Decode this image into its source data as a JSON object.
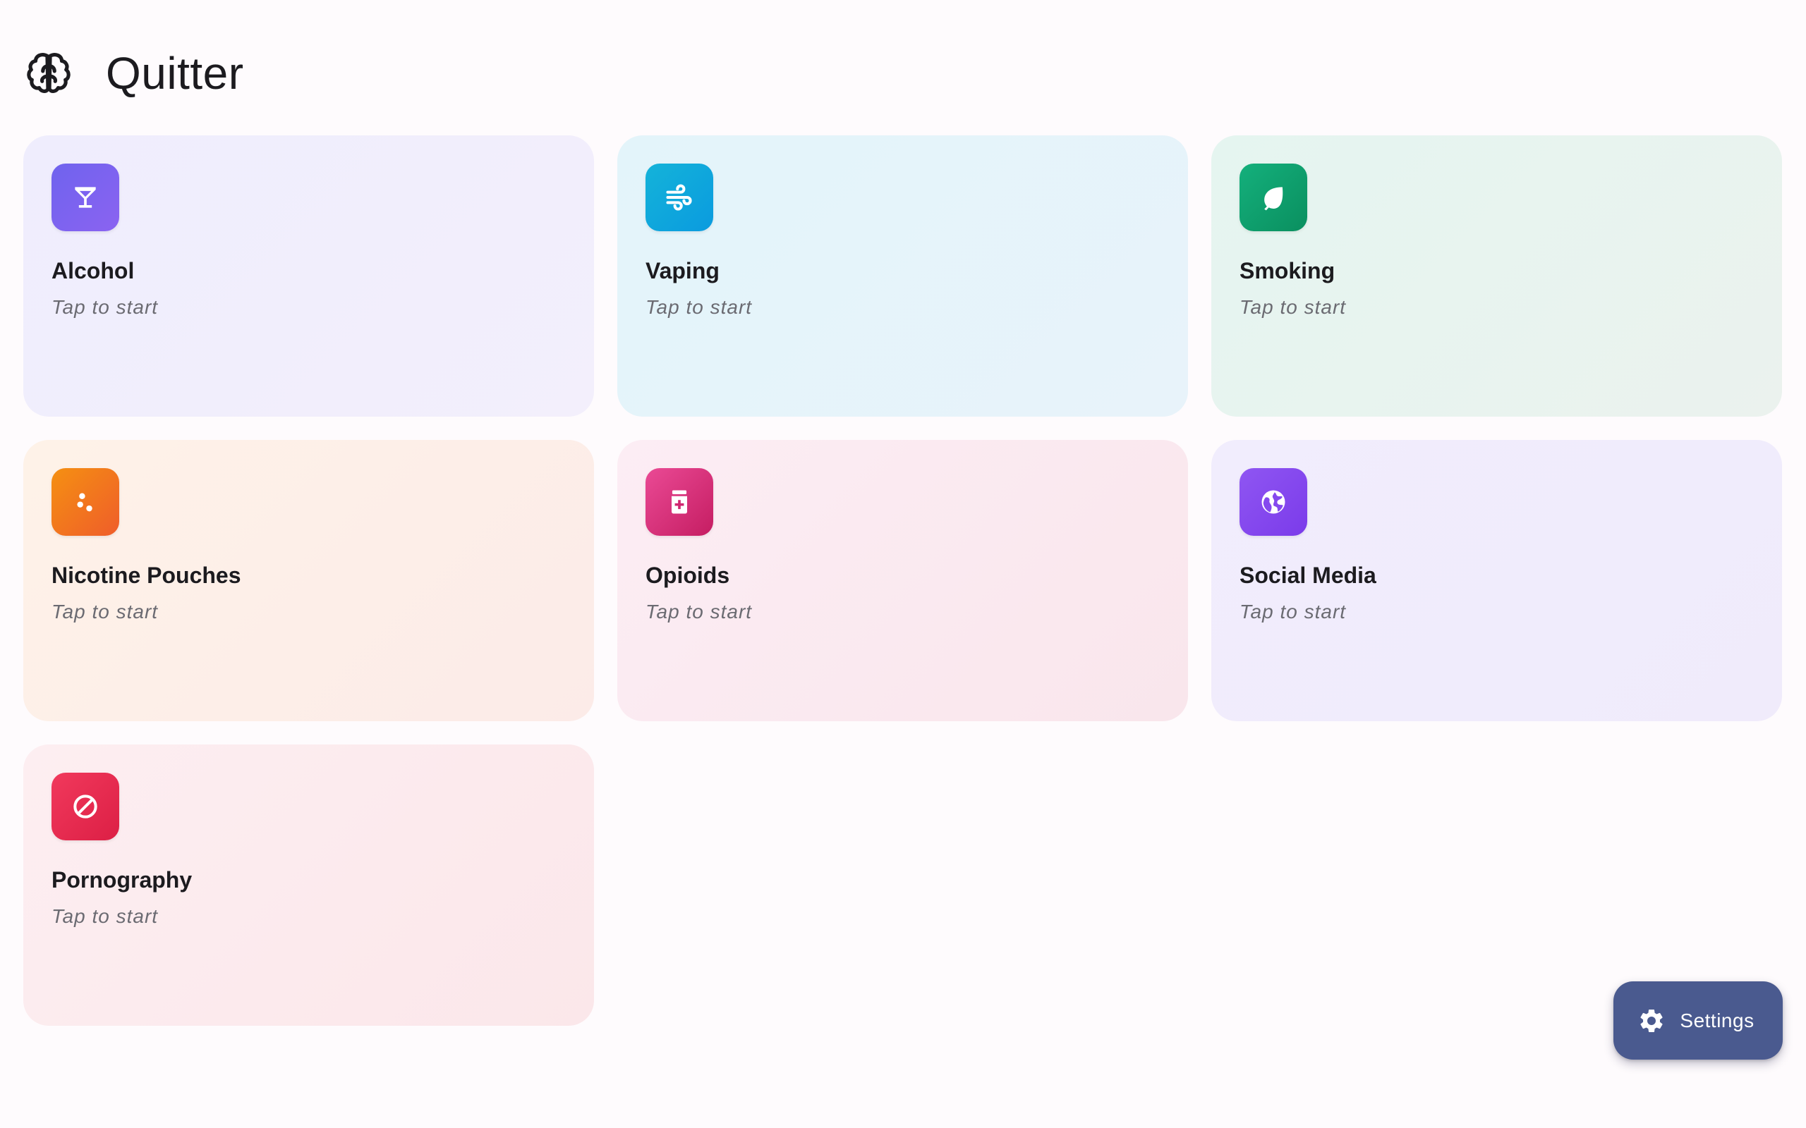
{
  "app": {
    "title": "Quitter",
    "logo_icon": "brain-icon"
  },
  "cards": [
    {
      "title": "Alcohol",
      "subtitle": "Tap to start",
      "icon": "cocktail-glass-icon",
      "accent": "#7b63f0"
    },
    {
      "title": "Vaping",
      "subtitle": "Tap to start",
      "icon": "wind-icon",
      "accent": "#0ea8dc"
    },
    {
      "title": "Smoking",
      "subtitle": "Tap to start",
      "icon": "leaf-icon",
      "accent": "#10a06e"
    },
    {
      "title": "Nicotine Pouches",
      "subtitle": "Tap to start",
      "icon": "dots-icon",
      "accent": "#f2771e"
    },
    {
      "title": "Opioids",
      "subtitle": "Tap to start",
      "icon": "medicine-bottle-icon",
      "accent": "#d8337b"
    },
    {
      "title": "Social Media",
      "subtitle": "Tap to start",
      "icon": "globe-icon",
      "accent": "#8549ee"
    },
    {
      "title": "Pornography",
      "subtitle": "Tap to start",
      "icon": "block-icon",
      "accent": "#e62c51"
    }
  ],
  "settings": {
    "label": "Settings",
    "icon": "gear-icon",
    "color": "#4a5a8f"
  }
}
